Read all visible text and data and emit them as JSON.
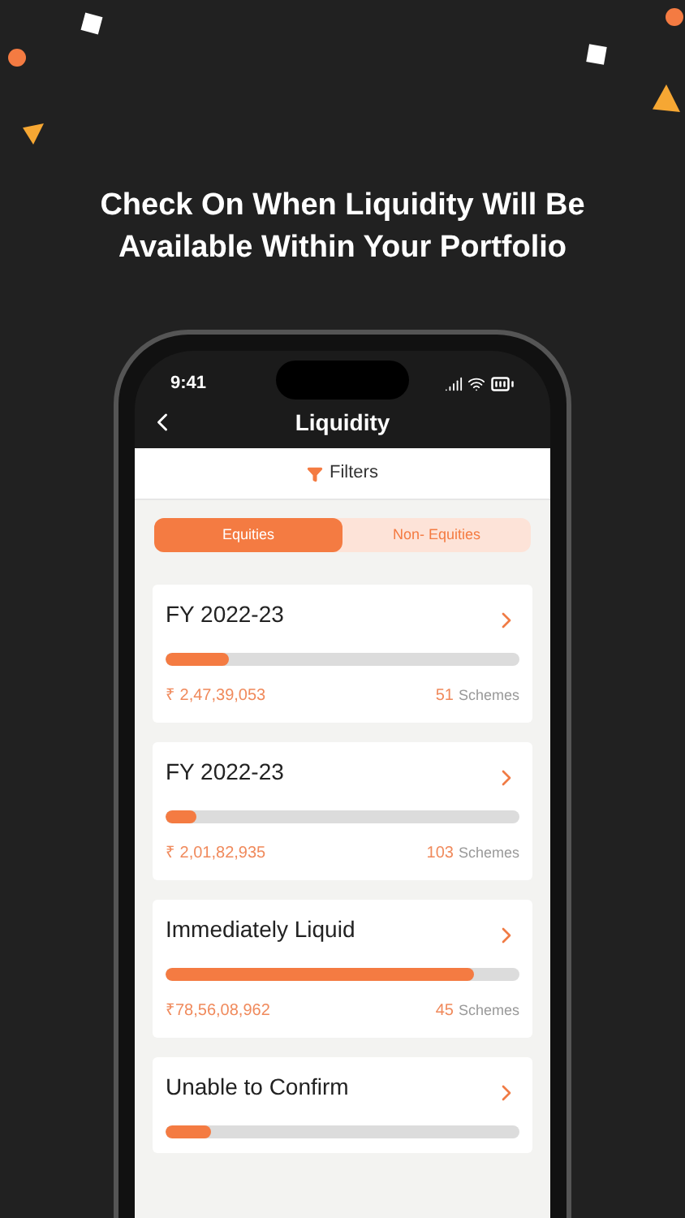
{
  "headline": "Check On When Liquidity Will Be Available Within Your Portfolio",
  "status_bar": {
    "time": "9:41"
  },
  "header": {
    "title": "Liquidity"
  },
  "filter": {
    "label": "Filters"
  },
  "tabs": [
    {
      "label": "Equities",
      "selected": true
    },
    {
      "label": "Non- Equities",
      "selected": false
    }
  ],
  "cards": [
    {
      "title": "FY 2022-23",
      "level": 0.18,
      "amount": "₹ 2,47,39,053",
      "count": "51",
      "count_label": "Schemes"
    },
    {
      "title": "FY 2022-23",
      "level": 0.085,
      "amount": "₹ 2,01,82,935",
      "count": "103",
      "count_label": "Schemes"
    },
    {
      "title": "Immediately Liquid",
      "level": 0.87,
      "amount": "₹78,56,08,962",
      "count": "45",
      "count_label": "Schemes"
    },
    {
      "title": "Unable to Confirm",
      "level": 0.13
    }
  ]
}
